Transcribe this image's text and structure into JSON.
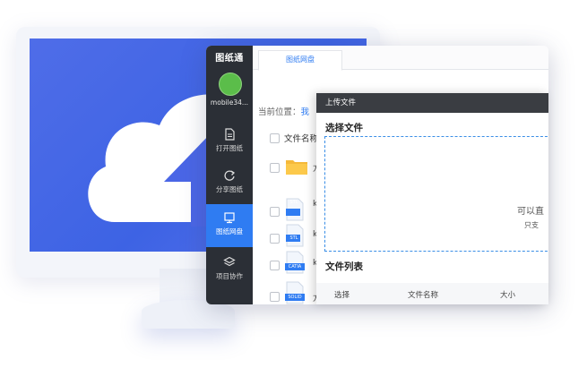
{
  "app": {
    "logo": "图纸通",
    "username": "mobile34..."
  },
  "sidebar": {
    "items": [
      {
        "label": "打开图纸",
        "icon": "open-drawing-icon",
        "active": false
      },
      {
        "label": "分享图纸",
        "icon": "share-drawing-icon",
        "active": false
      },
      {
        "label": "图纸网盘",
        "icon": "cloud-disk-icon",
        "active": true
      },
      {
        "label": "项目协作",
        "icon": "project-collab-icon",
        "active": false
      }
    ]
  },
  "tabs": [
    {
      "label": "图纸网盘"
    }
  ],
  "breadcrumb": {
    "prefix": "当前位置：",
    "link": "我"
  },
  "file_table": {
    "header_name": "文件名称",
    "rows": [
      {
        "type": "folder",
        "badge": "",
        "name": "方"
      },
      {
        "type": "file",
        "badge": "STL",
        "name": "k"
      },
      {
        "type": "file",
        "badge": "STL",
        "name": "k"
      },
      {
        "type": "file",
        "badge": "CATIA",
        "name": "k"
      },
      {
        "type": "file",
        "badge": "SOLID",
        "name": "方"
      }
    ]
  },
  "upload_dialog": {
    "title": "上传文件",
    "select_section": "选择文件",
    "dropzone_text": "可以直",
    "dropzone_subtext": "只支",
    "list_section": "文件列表",
    "columns": [
      "选择",
      "文件名称",
      "大小"
    ]
  },
  "colors": {
    "accent": "#2f7cf2",
    "sidebar": "#2b2f36",
    "dialog_title": "#3a3d42",
    "screen_blue": "#4569e6"
  }
}
